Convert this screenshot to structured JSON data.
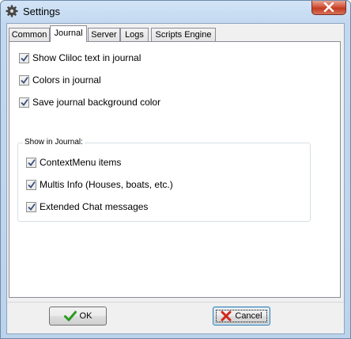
{
  "window": {
    "title": "Settings",
    "icons": {
      "app": "gear-icon",
      "close": "close-icon"
    }
  },
  "tabs": [
    {
      "label": "Common",
      "active": false
    },
    {
      "label": "Journal",
      "active": true
    },
    {
      "label": "Server",
      "active": false
    },
    {
      "label": "Logs",
      "active": false
    },
    {
      "label": "Scripts Engine",
      "active": false
    }
  ],
  "journal": {
    "options": [
      {
        "label": "Show Cliloc text in journal",
        "checked": true
      },
      {
        "label": "Colors in journal",
        "checked": true
      },
      {
        "label": "Save journal background color",
        "checked": true
      }
    ],
    "show_in_journal": {
      "legend": "Show in Journal:",
      "options": [
        {
          "label": "ContextMenu items",
          "checked": true
        },
        {
          "label": "Multis Info (Houses, boats, etc.)",
          "checked": true
        },
        {
          "label": "Extended Chat messages",
          "checked": true
        }
      ]
    }
  },
  "buttons": {
    "ok": {
      "label": "OK",
      "icon": "green-checkmark-icon",
      "color": "#2e9a1f"
    },
    "cancel": {
      "label": "Cancel",
      "icon": "red-x-icon",
      "color": "#d0261b"
    }
  }
}
